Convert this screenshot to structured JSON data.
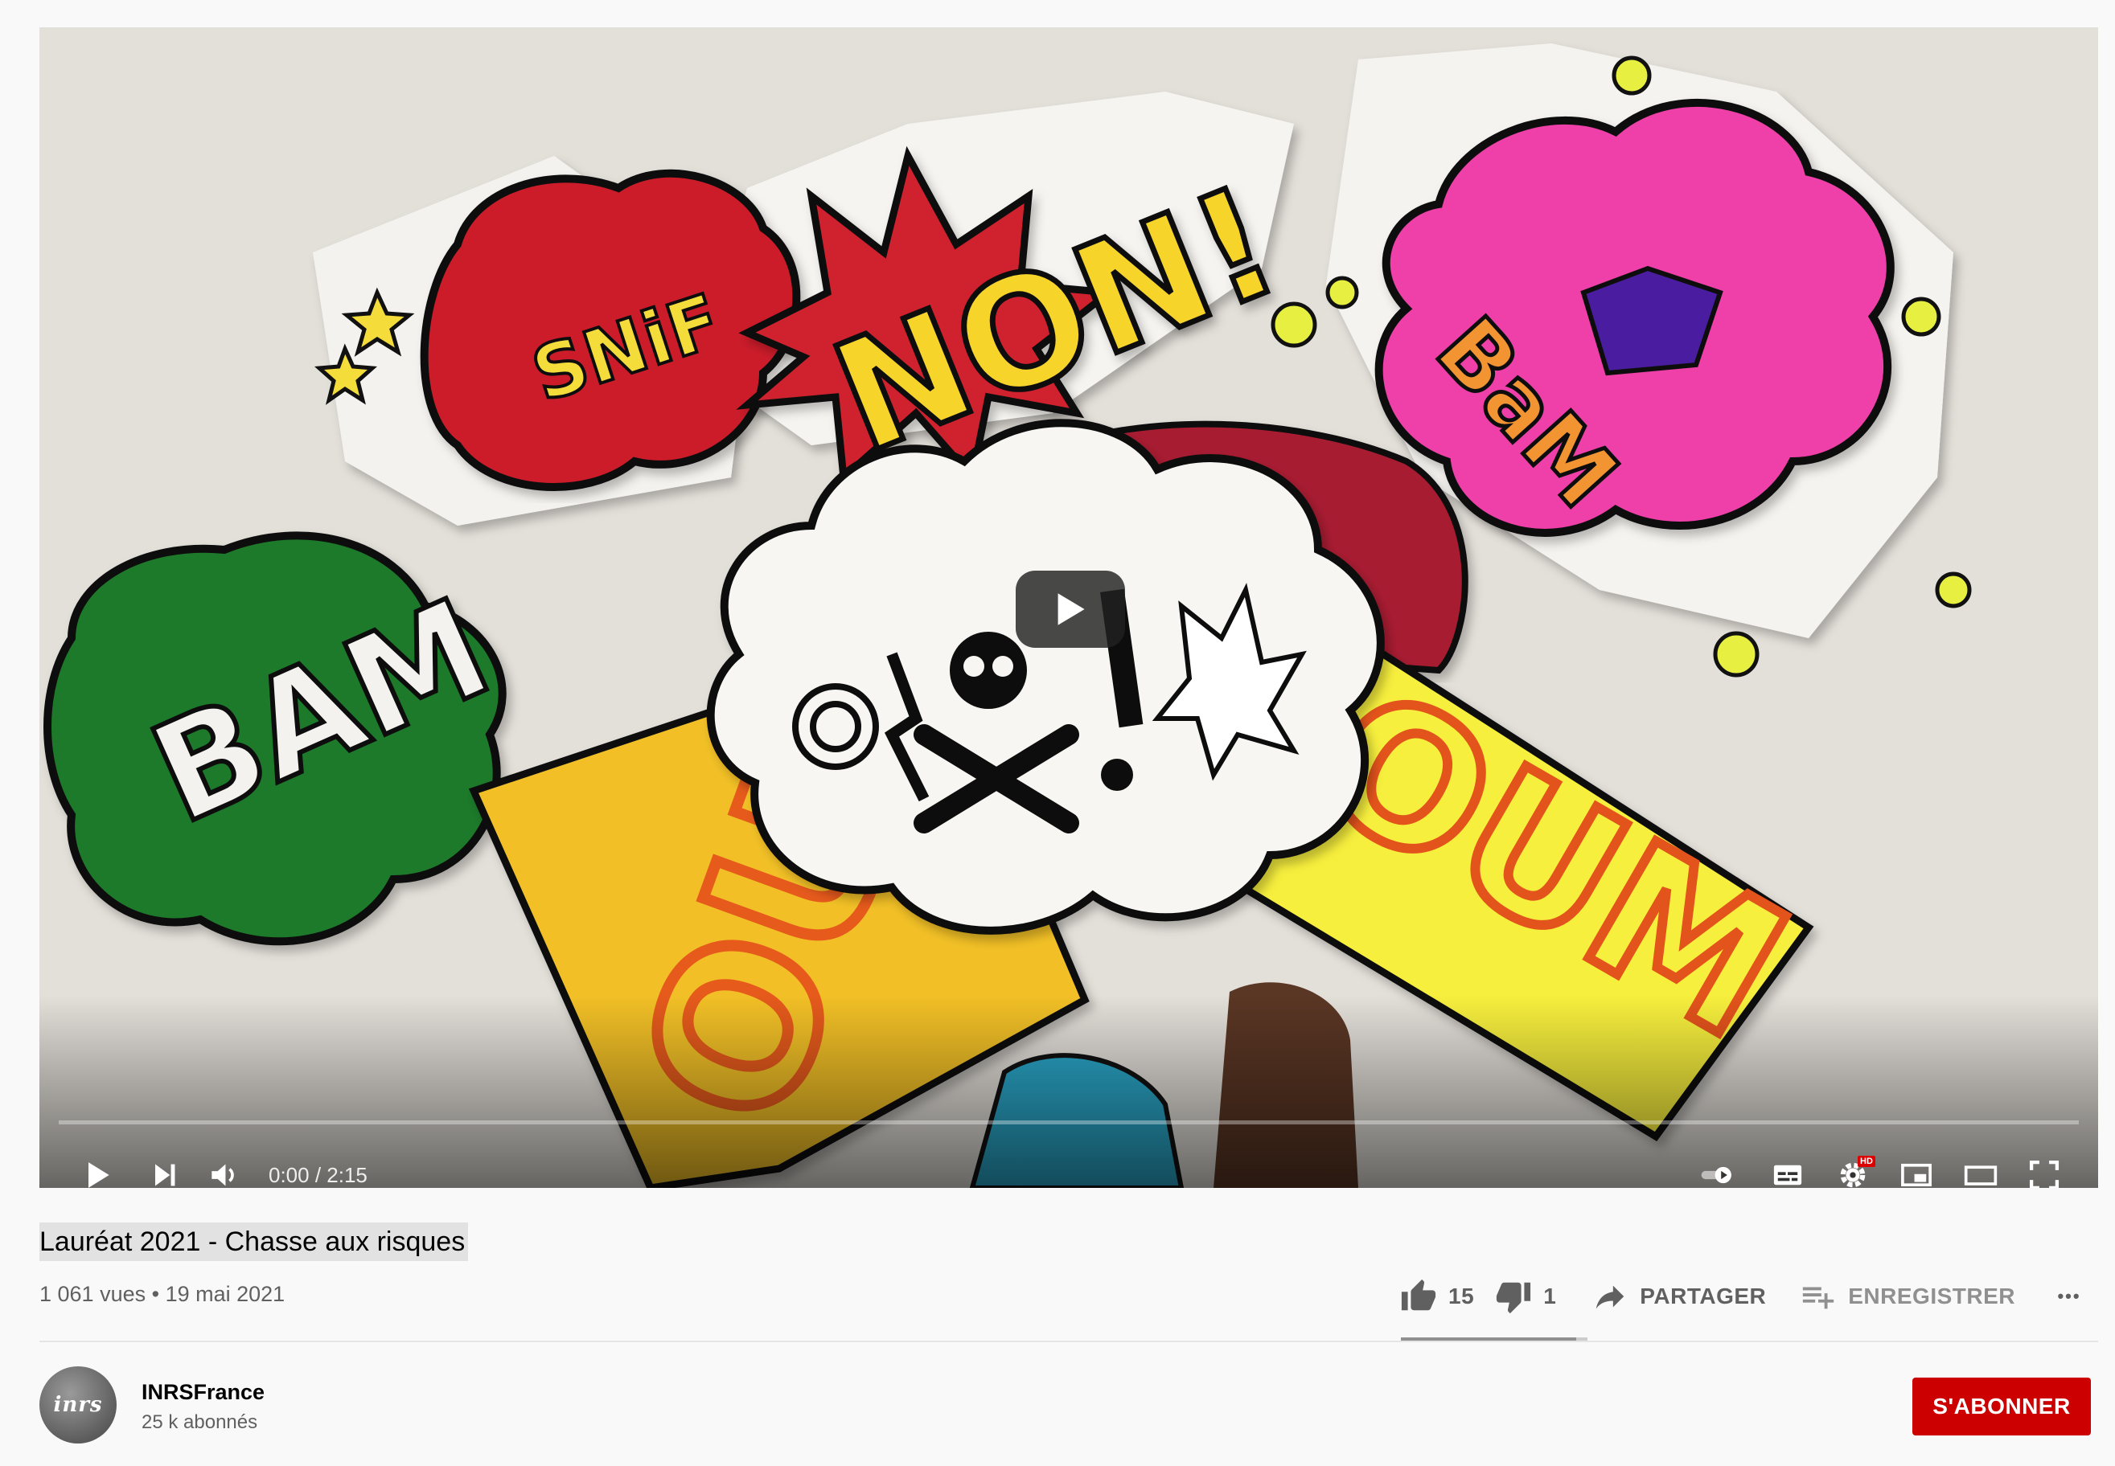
{
  "player": {
    "current_time": "0:00",
    "separator": " / ",
    "duration": "2:15",
    "progress": 0,
    "hd_badge": "HD",
    "artwork_words": [
      "SNiF",
      "NON!",
      "BaM",
      "BAM",
      "OUM",
      "OU"
    ],
    "controls": [
      "play-icon",
      "next-icon",
      "volume-icon",
      "autoplay-toggle-icon",
      "subtitles-icon",
      "settings-icon",
      "miniplayer-icon",
      "theater-mode-icon",
      "fullscreen-icon"
    ]
  },
  "video": {
    "title": "Lauréat 2021 - Chasse aux risques",
    "views": "1 061 vues",
    "bullet": " • ",
    "date": "19 mai 2021"
  },
  "actions": {
    "likes": "15",
    "dislikes": "1",
    "like_ratio": 0.9375,
    "share_label": "PARTAGER",
    "save_label": "ENREGISTRER",
    "more_label": "•••"
  },
  "channel": {
    "name": "INRSFrance",
    "subscribers": "25 k abonnés",
    "avatar_text": "inrs",
    "subscribe_label": "S'ABONNER"
  },
  "colors": {
    "subscribe": "#cc0000",
    "progress": "#ff0000",
    "text_secondary": "#606060"
  }
}
